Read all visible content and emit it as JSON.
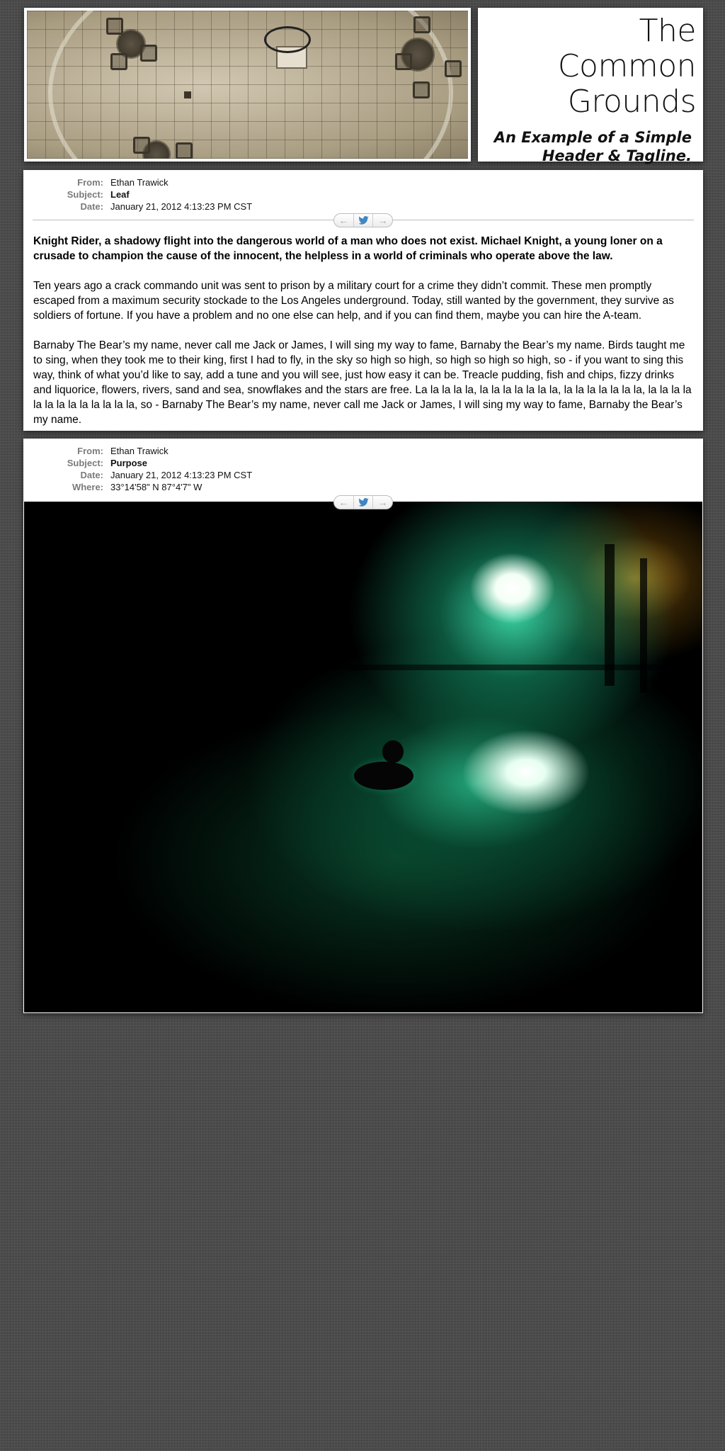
{
  "site": {
    "title_lines": [
      "The",
      "Common",
      "Grounds"
    ],
    "tagline_lines": [
      "An Example of a Simple",
      "Header & Tagline."
    ]
  },
  "meta_labels": {
    "from": "From:",
    "subject": "Subject:",
    "date": "Date:",
    "where": "Where:"
  },
  "post_nav": {
    "prev_icon": "←",
    "share_icon": "🐦",
    "next_icon": "→"
  },
  "posts": [
    {
      "from": "Ethan Trawick",
      "subject": "Leaf",
      "date": "January 21, 2012 4:13:23 PM CST",
      "paragraphs": [
        "Knight Rider, a shadowy flight into the dangerous world of a man who does not exist. Michael Knight, a young loner on a crusade to champion the cause of the innocent, the helpless in a world of criminals who operate above the law.",
        "Ten years ago a crack commando unit was sent to prison by a military court for a crime they didn’t commit. These men promptly escaped from a maximum security stockade to the Los Angeles underground. Today, still wanted by the government, they survive as soldiers of fortune. If you have a problem and no one else can help, and if you can find them, maybe you can hire the A-team.",
        "Barnaby The Bear’s my name, never call me Jack or James, I will sing my way to fame, Barnaby the Bear’s my name. Birds taught me to sing, when they took me to their king, first I had to fly, in the sky so high so high, so high so high so high, so - if you want to sing this way, think of what you’d like to say, add a tune and you will see, just how easy it can be. Treacle pudding, fish and chips, fizzy drinks and liquorice, flowers, rivers, sand and sea, snowflakes and the stars are free. La la la la la, la la la la la la la, la la la la la la la, la la la la la la la la la la la la la, so - Barnaby The Bear’s my name, never call me Jack or James, I will sing my way to fame, Barnaby the Bear’s my name."
      ]
    },
    {
      "from": "Ethan Trawick",
      "subject": "Purpose",
      "date": "January 21, 2012 4:13:23 PM CST",
      "where": "33°14'58\" N 87°4'7\" W"
    }
  ]
}
